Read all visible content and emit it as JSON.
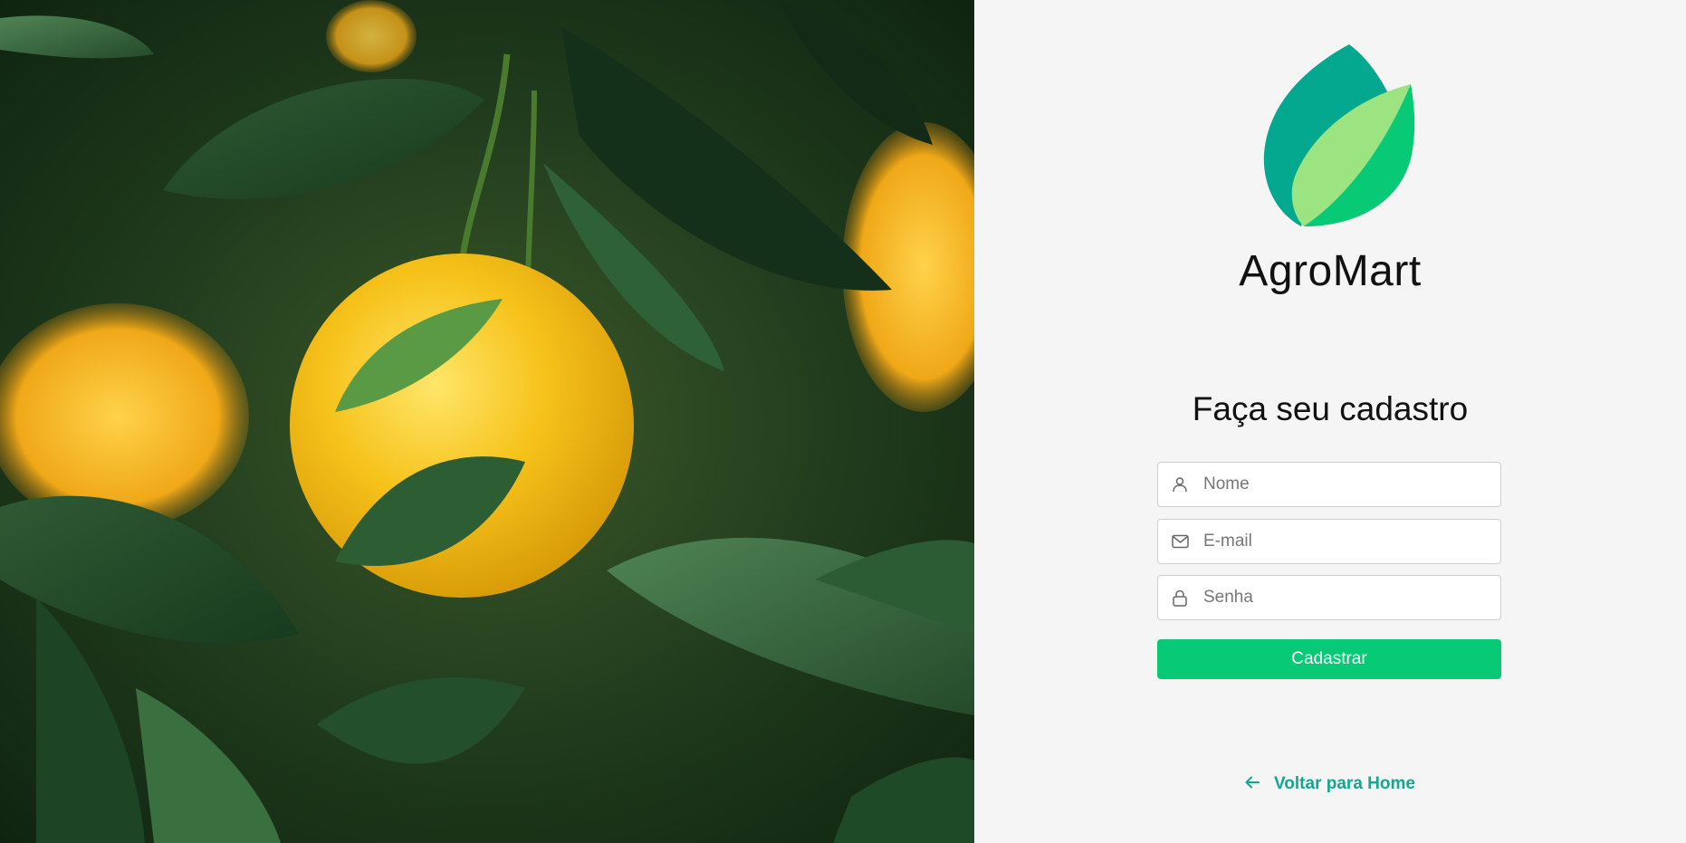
{
  "brand": {
    "name": "AgroMart",
    "colors": {
      "leaf_dark": "#03a88f",
      "leaf_light": "#9be481",
      "leaf_mid": "#08c975"
    }
  },
  "form": {
    "title": "Faça seu cadastro",
    "name_field": {
      "placeholder": "Nome",
      "value": "",
      "icon": "user-icon"
    },
    "email_field": {
      "placeholder": "E-mail",
      "value": "",
      "icon": "mail-icon"
    },
    "password_field": {
      "placeholder": "Senha",
      "value": "",
      "icon": "lock-icon"
    },
    "submit_label": "Cadastrar",
    "submit_color": "#08c975"
  },
  "footer": {
    "back_label": "Voltar para Home",
    "back_icon": "arrow-left-icon",
    "link_color": "#12a88f"
  }
}
